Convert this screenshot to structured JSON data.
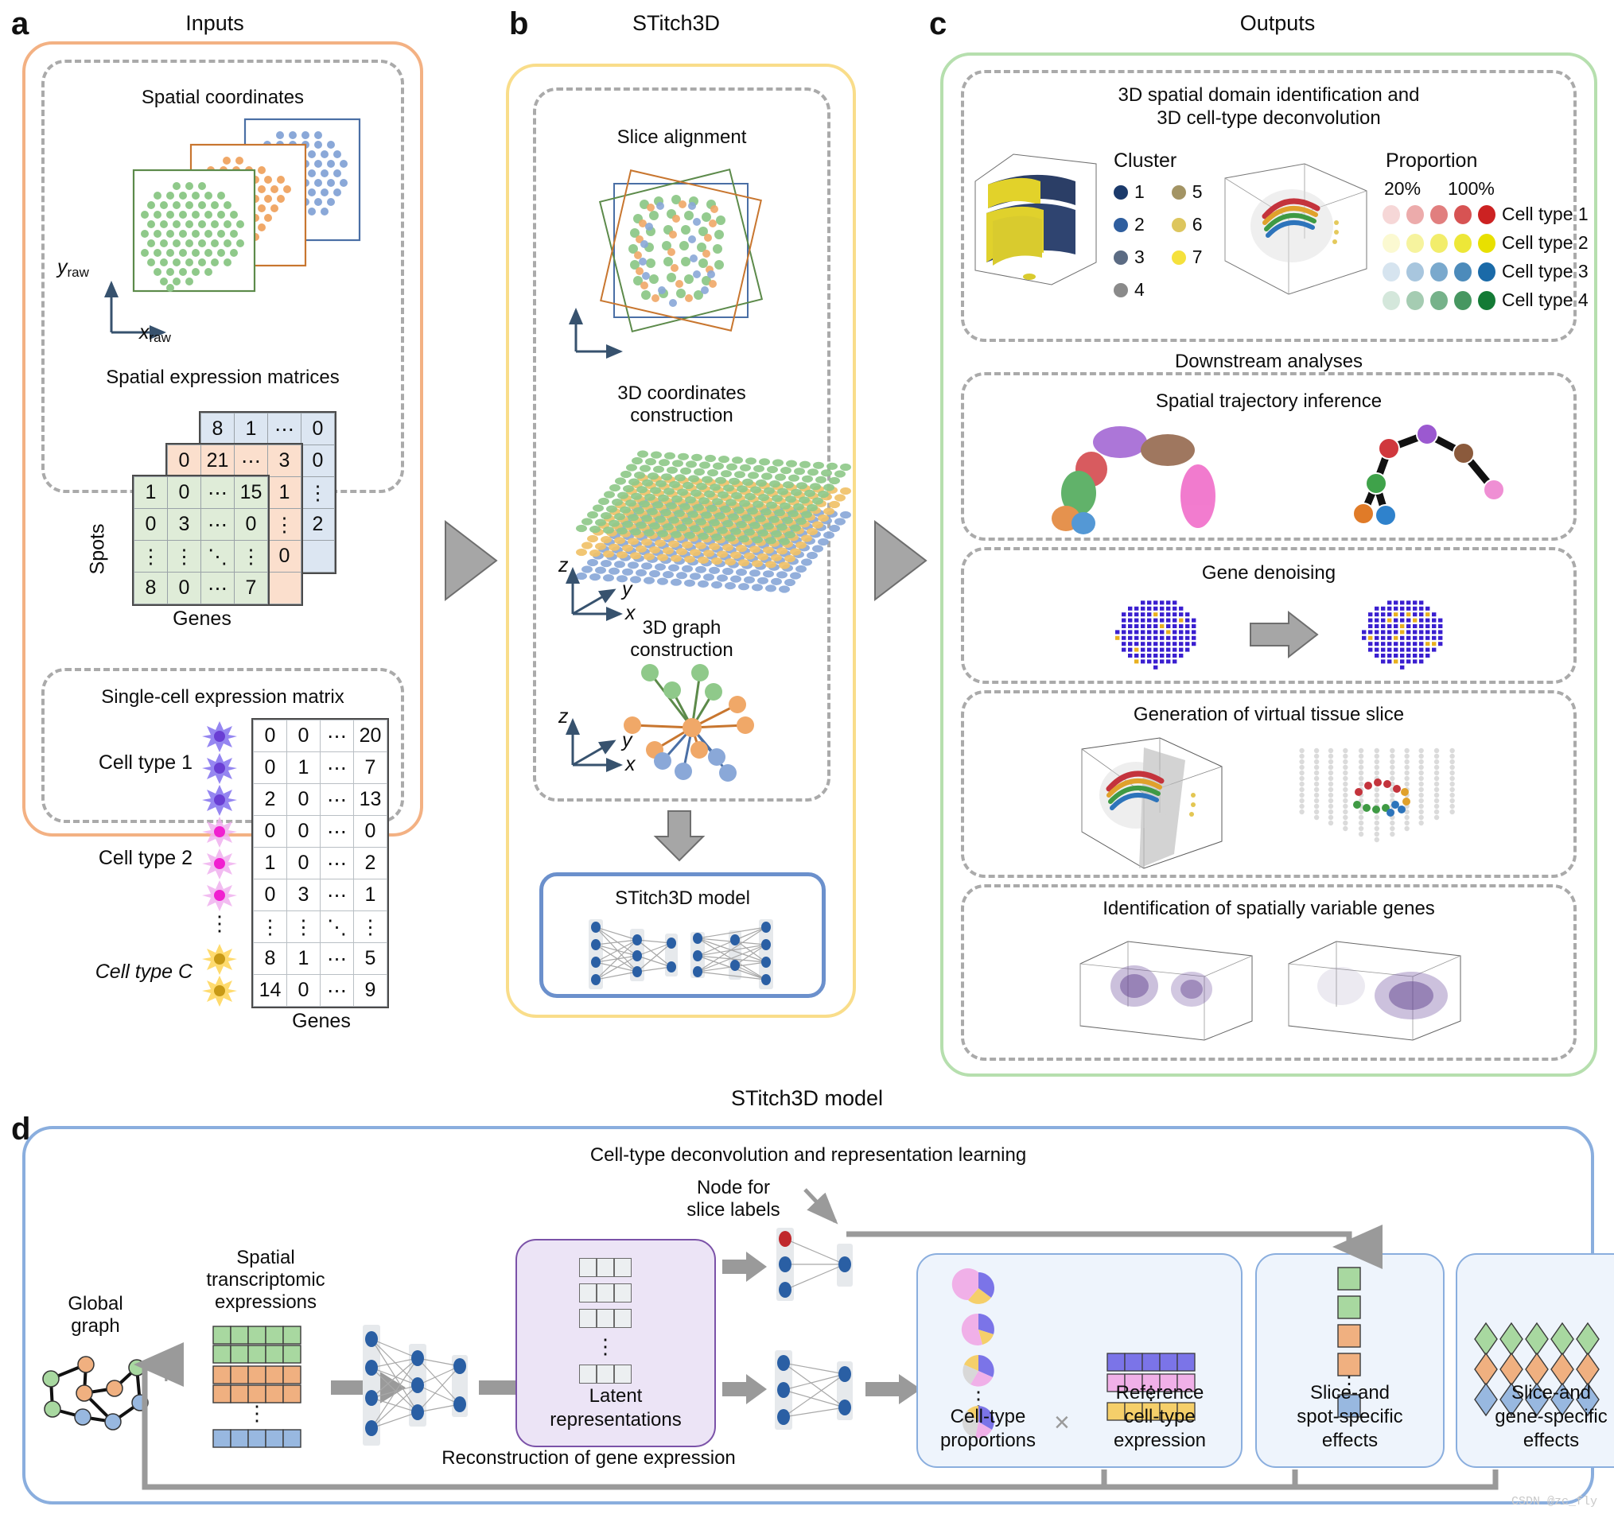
{
  "figure": {
    "watermark": "CSDN @zc_fly"
  },
  "panel_a": {
    "letter": "a",
    "title": "Inputs",
    "spatial_coordinates": {
      "title": "Spatial coordinates",
      "y_axis": "y",
      "y_axis_sub": "raw",
      "x_axis": "x",
      "x_axis_sub": "raw",
      "slice_colors": [
        "#8fc98a",
        "#f0a868",
        "#8aa8d8"
      ]
    },
    "expression_matrices": {
      "title": "Spatial expression matrices",
      "row_label": "Spots",
      "col_label": "Genes",
      "blue_matrix": [
        [
          "8",
          "1",
          "⋯",
          "0"
        ],
        [
          "",
          "",
          "",
          ""
        ]
      ],
      "blue_values": [
        "8",
        "1",
        "⋯",
        "0",
        "0",
        "⋮",
        "2"
      ],
      "peach_values": [
        "0",
        "21",
        "⋯",
        "3",
        "1",
        "⋮",
        "0"
      ],
      "green_matrix": [
        [
          "1",
          "0",
          "⋯",
          "15"
        ],
        [
          "0",
          "3",
          "⋯",
          "0"
        ],
        [
          "⋮",
          "⋮",
          "⋱",
          "⋮"
        ],
        [
          "8",
          "0",
          "⋯",
          "7"
        ]
      ]
    },
    "singlecell_matrix": {
      "title": "Single-cell expression matrix",
      "col_label": "Genes",
      "cell_type_labels": [
        "Cell type 1",
        "Cell type 2",
        "Cell type C"
      ],
      "dots_label": "⋮",
      "rows": [
        [
          "0",
          "0",
          "⋯",
          "20"
        ],
        [
          "0",
          "1",
          "⋯",
          "7"
        ],
        [
          "2",
          "0",
          "⋯",
          "13"
        ],
        [
          "0",
          "0",
          "⋯",
          "0"
        ],
        [
          "1",
          "0",
          "⋯",
          "2"
        ],
        [
          "0",
          "3",
          "⋯",
          "1"
        ],
        [
          "⋮",
          "⋮",
          "⋱",
          "⋮"
        ],
        [
          "8",
          "1",
          "⋯",
          "5"
        ],
        [
          "14",
          "0",
          "⋯",
          "9"
        ]
      ],
      "star_colors": [
        "#7b68ee",
        "#ee82ee",
        "#f5c842"
      ]
    }
  },
  "panel_b": {
    "letter": "b",
    "title": "STitch3D",
    "slice_alignment": {
      "title": "Slice alignment"
    },
    "coords_construction": {
      "title": "3D coordinates\nconstruction",
      "line1": "3D coordinates",
      "line2": "construction",
      "z": "z",
      "y": "y",
      "x": "x"
    },
    "graph_construction": {
      "line1": "3D graph",
      "line2": "construction",
      "z": "z",
      "y": "y",
      "x": "x"
    },
    "model_box": {
      "title": "STitch3D model"
    }
  },
  "panel_c": {
    "letter": "c",
    "title": "Outputs",
    "domain_section": {
      "line1": "3D spatial domain identification and",
      "line2": "3D cell-type deconvolution",
      "cluster_legend_title": "Cluster",
      "cluster_items": [
        {
          "label": "1",
          "color": "#1b3a6b"
        },
        {
          "label": "2",
          "color": "#2f5e9e"
        },
        {
          "label": "3",
          "color": "#5b6b83"
        },
        {
          "label": "4",
          "color": "#8a8a8a"
        },
        {
          "label": "5",
          "color": "#a39464"
        },
        {
          "label": "6",
          "color": "#ddc65e"
        },
        {
          "label": "7",
          "color": "#f5e13c"
        }
      ],
      "proportion_legend_title": "Proportion",
      "proportion_min": "20%",
      "proportion_max": "100%",
      "cell_types": [
        {
          "label": "Cell type 1",
          "color": "#cc2222"
        },
        {
          "label": "Cell type 2",
          "color": "#e8e000"
        },
        {
          "label": "Cell type 3",
          "color": "#1a6aa8"
        },
        {
          "label": "Cell type 4",
          "color": "#137a35"
        }
      ]
    },
    "downstream_title": "Downstream analyses",
    "sections": [
      {
        "title": "Spatial trajectory inference"
      },
      {
        "title": "Gene denoising"
      },
      {
        "title": "Generation of virtual tissue slice"
      },
      {
        "title": "Identification of spatially variable genes"
      }
    ]
  },
  "panel_d": {
    "letter": "d",
    "title": "STitch3D model",
    "header": "Cell-type deconvolution and representation learning",
    "global_graph": {
      "line1": "Global",
      "line2": "graph"
    },
    "plus": "+",
    "spatial_expr": {
      "line1": "Spatial",
      "line2": "transcriptomic",
      "line3": "expressions"
    },
    "latent": {
      "line1": "Latent",
      "line2": "representations"
    },
    "node_slice": {
      "line1": "Node for",
      "line2": "slice labels"
    },
    "multiply": "×",
    "outputs": [
      {
        "line1": "Cell-type",
        "line2": "proportions"
      },
      {
        "line1": "Reference",
        "line2": "cell-type",
        "line3": "expression"
      },
      {
        "line1": "Slice-and",
        "line2": "spot-specific",
        "line3": "effects"
      },
      {
        "line1": "Slice-and",
        "line2": "gene-specific",
        "line3": "effects"
      }
    ],
    "reconstruction": "Reconstruction of gene expression",
    "dots": "⋮"
  }
}
